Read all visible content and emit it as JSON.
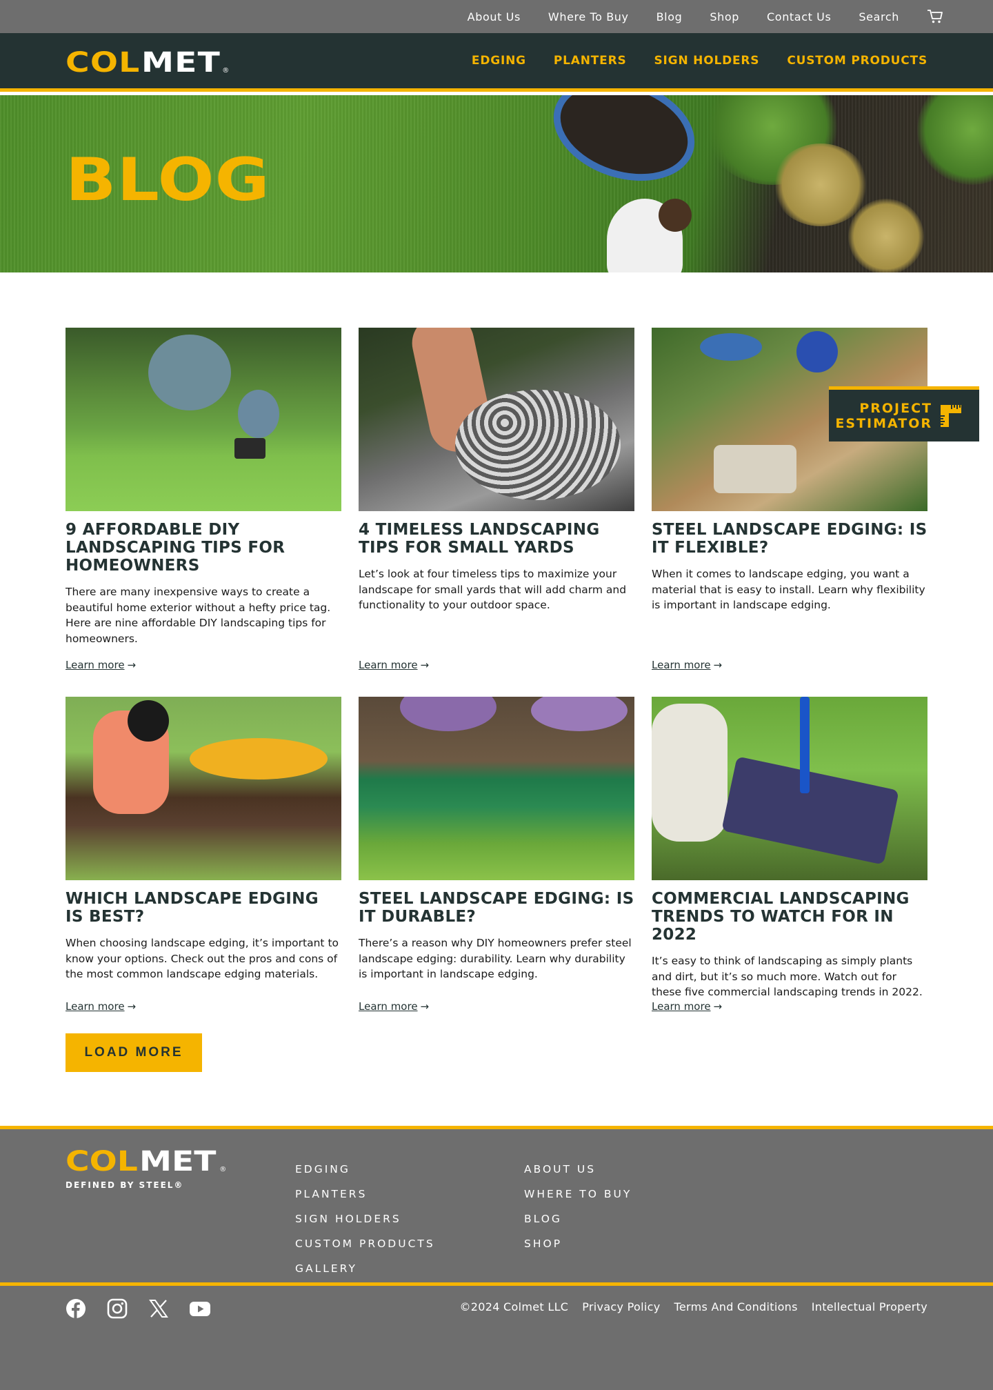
{
  "topbar": {
    "links": [
      "About Us",
      "Where To Buy",
      "Blog",
      "Shop",
      "Contact Us",
      "Search"
    ],
    "cart_icon": "cart-icon"
  },
  "brand": {
    "logo_part1": "COL",
    "logo_part2": "MET",
    "logo_reg": "®",
    "tagline": "DEFINED BY STEEL®",
    "accent_color": "#f5b400",
    "dark_color": "#243333",
    "gray_color": "#6e6e6e"
  },
  "mainnav": {
    "links": [
      "EDGING",
      "PLANTERS",
      "SIGN HOLDERS",
      "CUSTOM PRODUCTS"
    ]
  },
  "hero": {
    "title": "BLOG"
  },
  "posts": [
    {
      "title": "9 AFFORDABLE DIY LANDSCAPING TIPS FOR HOMEOWNERS",
      "excerpt": "There are many inexpensive ways to create a beautiful home exterior without a hefty price tag. Here are nine affordable DIY landscaping tips for homeowners.",
      "link": "Learn more"
    },
    {
      "title": "4 TIMELESS LANDSCAPING TIPS FOR SMALL YARDS",
      "excerpt": "Let’s look at four timeless tips to maximize your landscape for small yards that will add charm and functionality to your outdoor space.",
      "link": "Learn more"
    },
    {
      "title": "STEEL LANDSCAPE EDGING: IS IT FLEXIBLE?",
      "excerpt": "When it comes to landscape edging, you want a material that is easy to install. Learn why flexibility is important in landscape edging.",
      "link": "Learn more"
    },
    {
      "title": "WHICH LANDSCAPE EDGING IS BEST?",
      "excerpt": "When choosing landscape edging, it’s important to know your options. Check out the pros and cons of the most common landscape edging materials.",
      "link": "Learn more"
    },
    {
      "title": "STEEL LANDSCAPE EDGING: IS IT DURABLE?",
      "excerpt": "There’s a reason why DIY homeowners prefer steel landscape edging: durability. Learn why durability is important in landscape edging.",
      "link": "Learn more"
    },
    {
      "title": "COMMERCIAL LANDSCAPING TRENDS TO WATCH FOR IN 2022",
      "excerpt": "It’s easy to think of landscaping as simply plants and dirt, but it’s so much more. Watch out for these five commercial landscaping trends in 2022.",
      "link": "Learn more"
    }
  ],
  "estimator": {
    "line1": "PROJECT",
    "line2": "ESTIMATOR",
    "icon": "ruler-icon"
  },
  "load_more": "LOAD MORE",
  "footer": {
    "col1": [
      "EDGING",
      "PLANTERS",
      "SIGN HOLDERS",
      "CUSTOM PRODUCTS",
      "GALLERY"
    ],
    "col2": [
      "ABOUT US",
      "WHERE TO BUY",
      "BLOG",
      "SHOP"
    ],
    "social": [
      "facebook-icon",
      "instagram-icon",
      "x-icon",
      "youtube-icon"
    ],
    "copyright": "©2024 Colmet LLC",
    "legal": [
      "Privacy Policy",
      "Terms And Conditions",
      "Intellectual Property"
    ]
  }
}
